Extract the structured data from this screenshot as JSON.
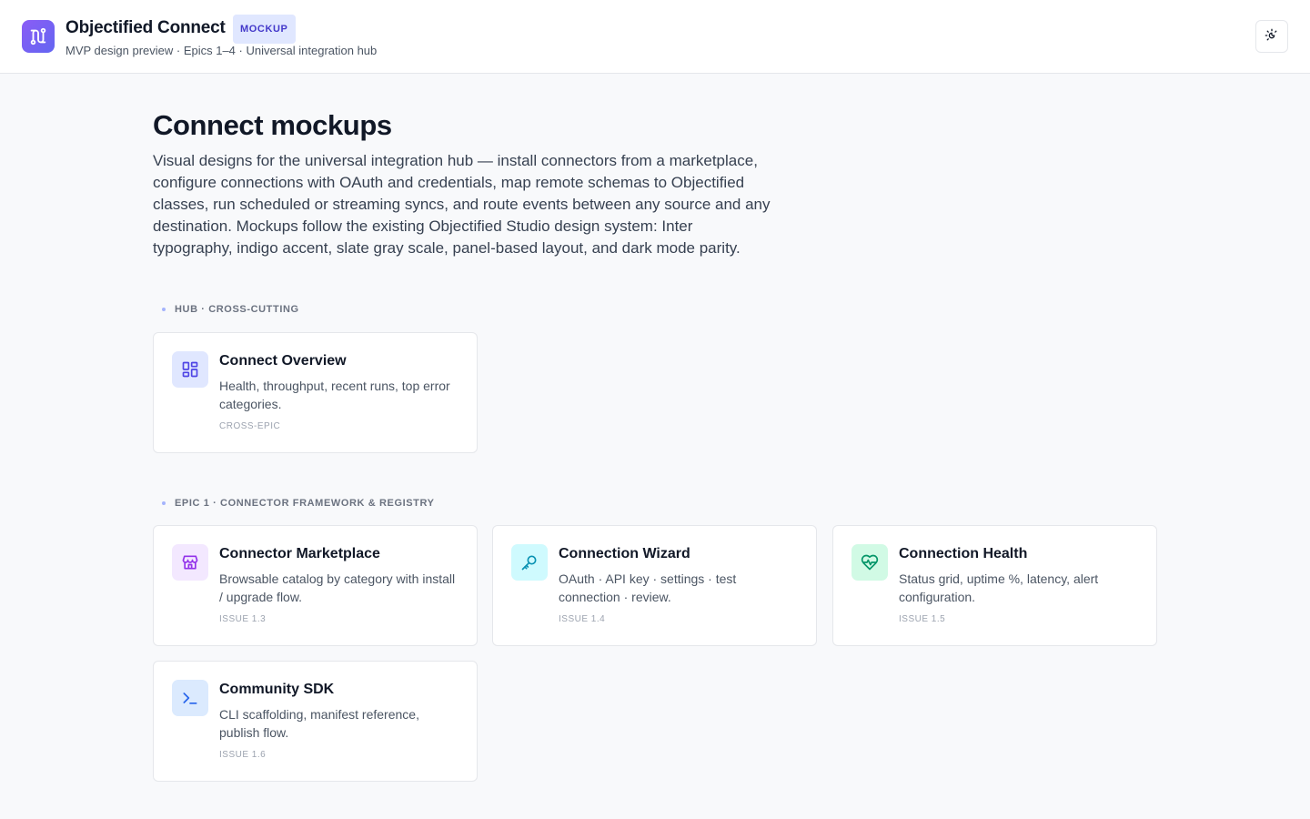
{
  "header": {
    "title": "Objectified Connect",
    "badge": "MOCKUP",
    "subtitle": "MVP design preview · Epics 1–4 · Universal integration hub",
    "logo_icon": "route-icon",
    "theme_toggle_icon": "theme-toggle-icon"
  },
  "intro": {
    "title": "Connect mockups",
    "description": "Visual designs for the universal integration hub — install connectors from a marketplace, configure connections with OAuth and credentials, map remote schemas to Objectified classes, run scheduled or streaming syncs, and route events between any source and any destination. Mockups follow the existing Objectified Studio design system: Inter typography, indigo accent, slate gray scale, panel-based layout, and dark mode parity."
  },
  "colors": {
    "accent": "#6366f1",
    "background": "#f8f9fb",
    "indigo_tint": "#e0e7ff",
    "purple_tint": "#f3e8ff",
    "cyan_tint": "#cffafe",
    "green_tint": "#d1fae5",
    "blue_tint": "#dbeafe"
  },
  "sections": [
    {
      "label": "HUB · CROSS-CUTTING",
      "cards": [
        {
          "title": "Connect Overview",
          "description": "Health, throughput, recent runs, top error categories.",
          "tag": "CROSS-EPIC",
          "icon": "dashboard-grid-icon"
        }
      ]
    },
    {
      "label": "EPIC 1 · CONNECTOR FRAMEWORK & REGISTRY",
      "cards": [
        {
          "title": "Connector Marketplace",
          "description": "Browsable catalog by category with install / upgrade flow.",
          "tag": "ISSUE 1.3",
          "icon": "store-icon"
        },
        {
          "title": "Connection Wizard",
          "description": "OAuth · API key · settings · test connection · review.",
          "tag": "ISSUE 1.4",
          "icon": "key-icon"
        },
        {
          "title": "Connection Health",
          "description": "Status grid, uptime %, latency, alert configuration.",
          "tag": "ISSUE 1.5",
          "icon": "heart-pulse-icon"
        },
        {
          "title": "Community SDK",
          "description": "CLI scaffolding, manifest reference, publish flow.",
          "tag": "ISSUE 1.6",
          "icon": "terminal-icon"
        }
      ]
    }
  ]
}
